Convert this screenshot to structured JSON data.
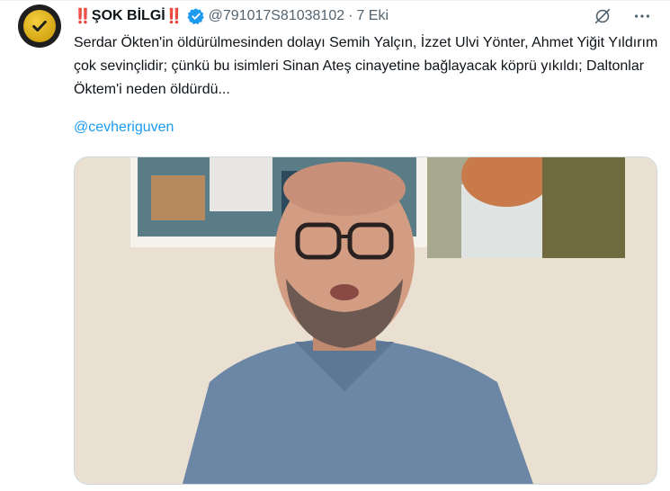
{
  "tweet": {
    "author_name": "ŞOK BİLGİ",
    "name_prefix": "‼️",
    "name_suffix": "‼️",
    "handle": "@791017S81038102",
    "separator": "·",
    "time": "7 Eki",
    "text": "Serdar Ökten'in öldürülmesinden dolayı Semih Yalçın, İzzet Ulvi Yönter, Ahmet Yiğit Yıldırım çok sevinçlidir; çünkü bu isimleri Sinan Ateş cinayetine bağlayacak köprü yıkıldı; Daltonlar Öktem'i neden öldürdü...",
    "mention": "@cevheriguven"
  },
  "icons": {
    "avatar": "avatar-gold-check",
    "verified": "verified-badge-icon",
    "grok": "grok-icon",
    "more": "more-icon"
  },
  "colors": {
    "link": "#1d9bf0",
    "secondary": "#536471",
    "bang": "#e0245e"
  }
}
